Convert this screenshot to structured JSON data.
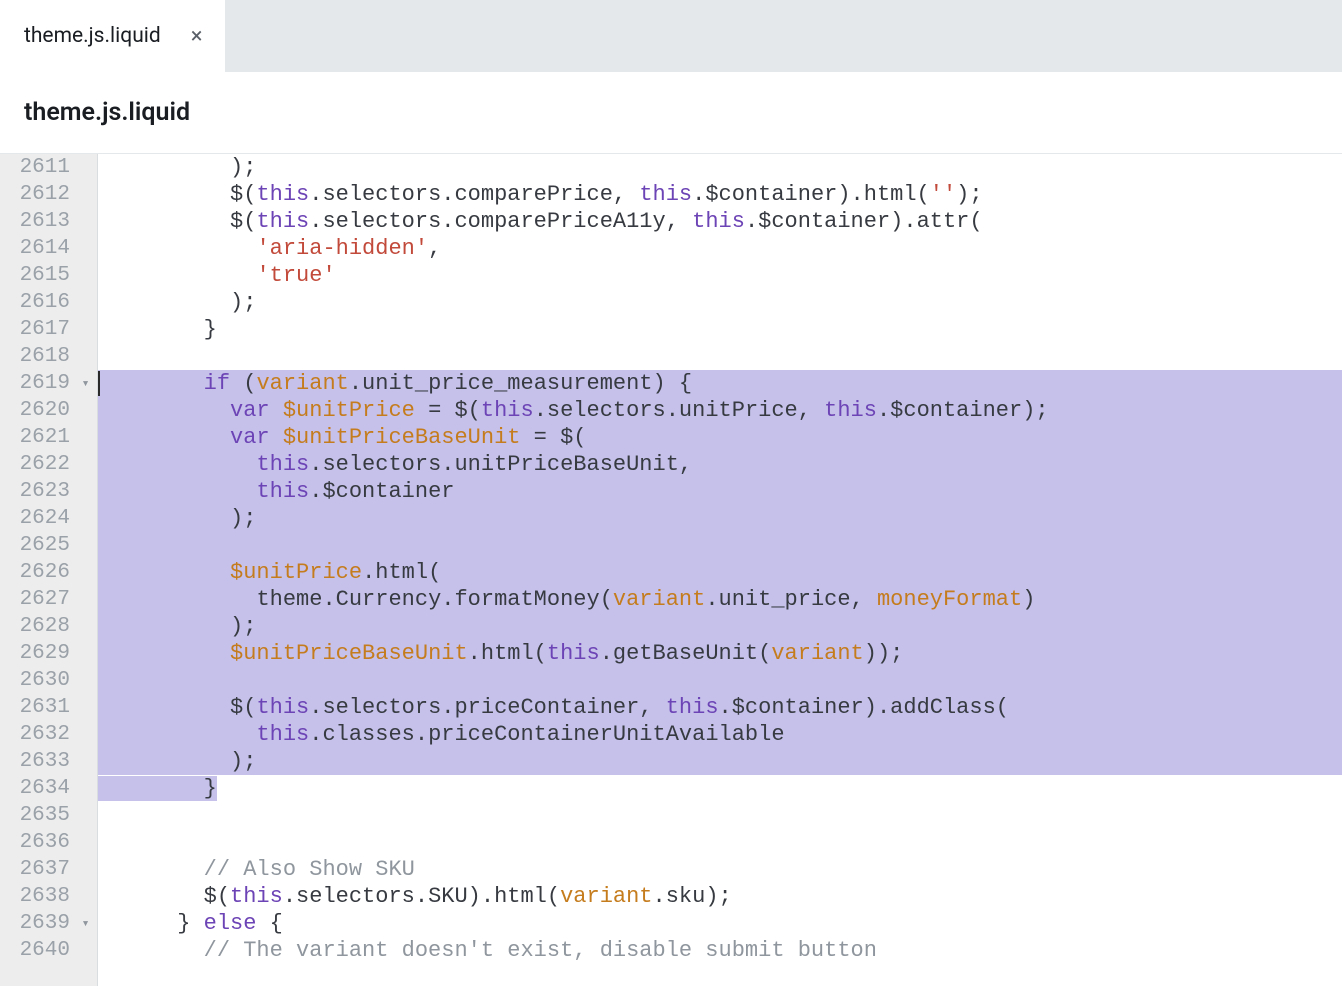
{
  "tab": {
    "label": "theme.js.liquid",
    "close": "×"
  },
  "breadcrumb": "theme.js.liquid",
  "gutter": {
    "start": 2611,
    "end": 2640,
    "fold_lines": [
      2619,
      2639
    ]
  },
  "code": {
    "l2611": {
      "indent": "          ",
      "text": ");"
    },
    "l2612": {
      "indent": "          ",
      "seg": [
        "$(",
        "this",
        ".selectors.comparePrice, ",
        "this",
        ".$container).html(",
        "''",
        ");"
      ]
    },
    "l2613": {
      "indent": "          ",
      "seg": [
        "$(",
        "this",
        ".selectors.comparePriceA11y, ",
        "this",
        ".$container).attr("
      ]
    },
    "l2614": {
      "indent": "            ",
      "seg": [
        "'aria-hidden'",
        ","
      ]
    },
    "l2615": {
      "indent": "            ",
      "seg": [
        "'true'"
      ]
    },
    "l2616": {
      "indent": "          ",
      "text": ");"
    },
    "l2617": {
      "indent": "        ",
      "text": "}"
    },
    "l2618": {
      "indent": "",
      "text": ""
    },
    "l2619": {
      "indent": "        ",
      "seg": [
        "if",
        " (",
        "variant",
        ".unit_price_measurement) {"
      ]
    },
    "l2620": {
      "indent": "          ",
      "seg": [
        "var",
        " ",
        "$unitPrice",
        " = $(",
        "this",
        ".selectors.unitPrice, ",
        "this",
        ".$container);"
      ]
    },
    "l2621": {
      "indent": "          ",
      "seg": [
        "var",
        " ",
        "$unitPriceBaseUnit",
        " = $("
      ]
    },
    "l2622": {
      "indent": "            ",
      "seg": [
        "this",
        ".selectors.unitPriceBaseUnit,"
      ]
    },
    "l2623": {
      "indent": "            ",
      "seg": [
        "this",
        ".$container"
      ]
    },
    "l2624": {
      "indent": "          ",
      "text": ");"
    },
    "l2625": {
      "indent": "",
      "text": ""
    },
    "l2626": {
      "indent": "          ",
      "seg": [
        "$unitPrice",
        ".html("
      ]
    },
    "l2627": {
      "indent": "            ",
      "seg": [
        "theme.Currency.formatMoney(",
        "variant",
        ".unit_price, ",
        "moneyFormat",
        ")"
      ]
    },
    "l2628": {
      "indent": "          ",
      "text": ");"
    },
    "l2629": {
      "indent": "          ",
      "seg": [
        "$unitPriceBaseUnit",
        ".html(",
        "this",
        ".getBaseUnit(",
        "variant",
        "));"
      ]
    },
    "l2630": {
      "indent": "",
      "text": ""
    },
    "l2631": {
      "indent": "          ",
      "seg": [
        "$(",
        "this",
        ".selectors.priceContainer, ",
        "this",
        ".$container).addClass("
      ]
    },
    "l2632": {
      "indent": "            ",
      "seg": [
        "this",
        ".classes.priceContainerUnitAvailable"
      ]
    },
    "l2633": {
      "indent": "          ",
      "text": ");"
    },
    "l2634": {
      "indent": "        ",
      "text": "}"
    },
    "l2635": {
      "indent": "",
      "text": ""
    },
    "l2636": {
      "indent": "",
      "text": ""
    },
    "l2637": {
      "indent": "        ",
      "seg": [
        "// Also Show SKU"
      ]
    },
    "l2638": {
      "indent": "        ",
      "seg": [
        "$(",
        "this",
        ".selectors.SKU).html(",
        "variant",
        ".sku);"
      ]
    },
    "l2639": {
      "indent": "      ",
      "seg": [
        "} ",
        "else",
        " {"
      ]
    },
    "l2640": {
      "indent": "        ",
      "seg": [
        "// The variant doesn't exist, disable submit button"
      ]
    }
  },
  "highlight": {
    "start": 2619,
    "end": 2634
  }
}
